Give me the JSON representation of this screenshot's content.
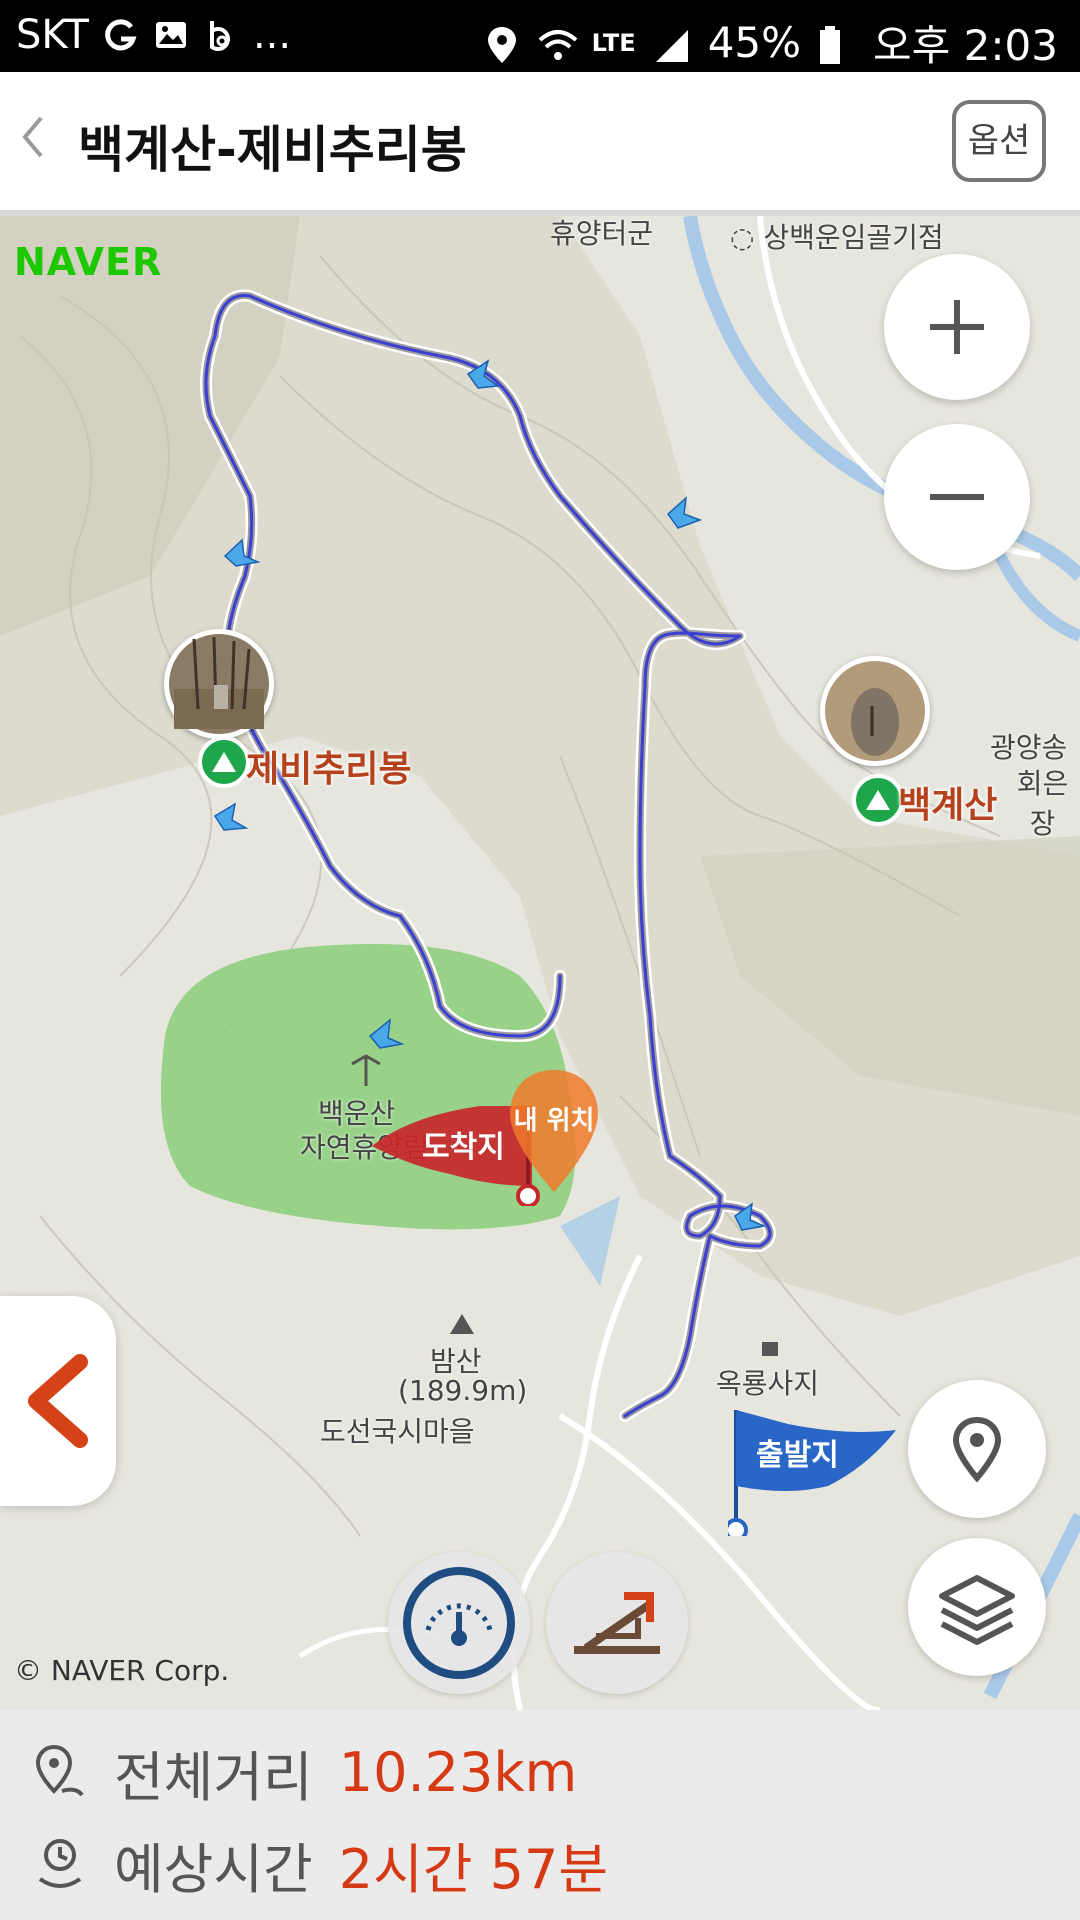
{
  "status_bar": {
    "carrier": "SKT",
    "dots": "...",
    "network": "LTE",
    "battery": "45%",
    "time": "오후 2:03"
  },
  "header": {
    "title": "백계산-제비추리봉",
    "option_label": "옵션"
  },
  "map": {
    "provider_logo": "NAVER",
    "copyright": "© NAVER Corp.",
    "zoom_in": "+",
    "zoom_out": "−",
    "peaks": [
      {
        "name": "제비추리봉"
      },
      {
        "name": "백계산"
      }
    ],
    "places": {
      "top_road": "휴양터군",
      "top_poi": "상백운임골기점",
      "right_poi_1": "광양송",
      "right_poi_2": "회은장",
      "park_1": "백운산",
      "park_2": "자연휴양림",
      "mountain_1": "밤산",
      "mountain_2": "(189.9m)",
      "village": "도선국시마을",
      "site": "옥룡사지"
    },
    "markers": {
      "arrival": "도착지",
      "my_location": "내 위치",
      "departure": "출발지"
    },
    "colors": {
      "route": "#3a3fd1",
      "arrow": "#4aa8e8",
      "arrival_flag": "#c8262a",
      "departure_flag": "#2a66c6",
      "park": "#8fcf7e",
      "peak_marker": "#20a64a"
    }
  },
  "summary": {
    "distance_label": "전체거리",
    "distance_value": "10.23km",
    "time_label": "예상시간",
    "time_value": "2시간 57분"
  }
}
